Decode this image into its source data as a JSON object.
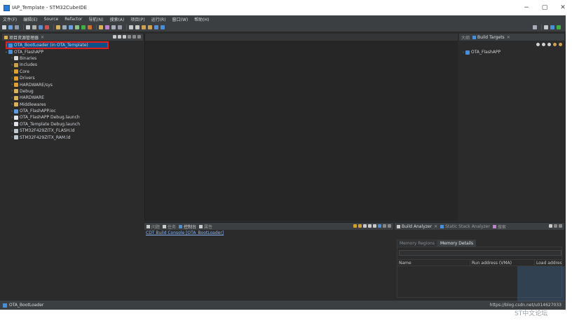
{
  "window": {
    "title": "IAP_Template - STM32CubeIDE",
    "minimize": "−",
    "maximize": "▢",
    "close": "✕"
  },
  "menu": [
    "文件(F)",
    "编辑(E)",
    "Source",
    "Refactor",
    "导航(N)",
    "搜索(A)",
    "项目(P)",
    "运行(R)",
    "窗口(W)",
    "帮助(H)"
  ],
  "explorer": {
    "title": "项目资源管理器",
    "items": [
      {
        "label": "OTA_BootLoader (in OTA_Template)",
        "level": 0,
        "icon": "project-icon",
        "selected": true
      },
      {
        "label": "OTA_FlashAPP",
        "level": 0,
        "icon": "project-icon",
        "expanded": true
      },
      {
        "label": "Binaries",
        "level": 1,
        "icon": "binaries-icon"
      },
      {
        "label": "Includes",
        "level": 1,
        "icon": "includes-icon"
      },
      {
        "label": "Core",
        "level": 1,
        "icon": "source-folder-icon"
      },
      {
        "label": "Drivers",
        "level": 1,
        "icon": "source-folder-icon"
      },
      {
        "label": "HARDWARE/sys",
        "level": 1,
        "icon": "source-folder-icon"
      },
      {
        "label": "Debug",
        "level": 1,
        "icon": "folder-icon"
      },
      {
        "label": "HARDWARE",
        "level": 1,
        "icon": "folder-icon"
      },
      {
        "label": "Middlewares",
        "level": 1,
        "icon": "folder-icon"
      },
      {
        "label": "OTA_FlashAPP.ioc",
        "level": 1,
        "icon": "ioc-file-icon"
      },
      {
        "label": "OTA_FlashAPP Debug.launch",
        "level": 1,
        "icon": "launch-file-icon"
      },
      {
        "label": "OTA_Template Debug.launch",
        "level": 1,
        "icon": "launch-file-icon"
      },
      {
        "label": "STM32F429ZITX_FLASH.ld",
        "level": 1,
        "icon": "linker-file-icon"
      },
      {
        "label": "STM32F429ZITX_RAM.ld",
        "level": 1,
        "icon": "linker-file-icon"
      }
    ]
  },
  "outline": {
    "tab_outline": "大纲",
    "tab_build_targets": "Build Targets",
    "items": [
      {
        "label": "OTA_FlashAPP"
      }
    ]
  },
  "console": {
    "tabs": [
      "问题",
      "任务",
      "控制台",
      "属性"
    ],
    "title": "CDT Build Console [OTA_BootLoader]"
  },
  "analyzer": {
    "tab_build_analyzer": "Build Analyzer",
    "tab_static_stack": "Static Stack Analyzer",
    "tab_search": "搜索",
    "subtabs": [
      "Memory Regions",
      "Memory Details"
    ],
    "columns": [
      "Name",
      "Run address (VMA)",
      "Load address"
    ]
  },
  "status": {
    "selected": "OTA_BootLoader",
    "url": "https://blog.csdn.net/u014627033"
  },
  "watermark": "ST中文论坛",
  "colors": {
    "background": "#2b2b2b",
    "panel_header": "#3c3f41",
    "selection": "#0f4f88",
    "highlight_box": "#e02020",
    "link": "#8ab4f8"
  }
}
